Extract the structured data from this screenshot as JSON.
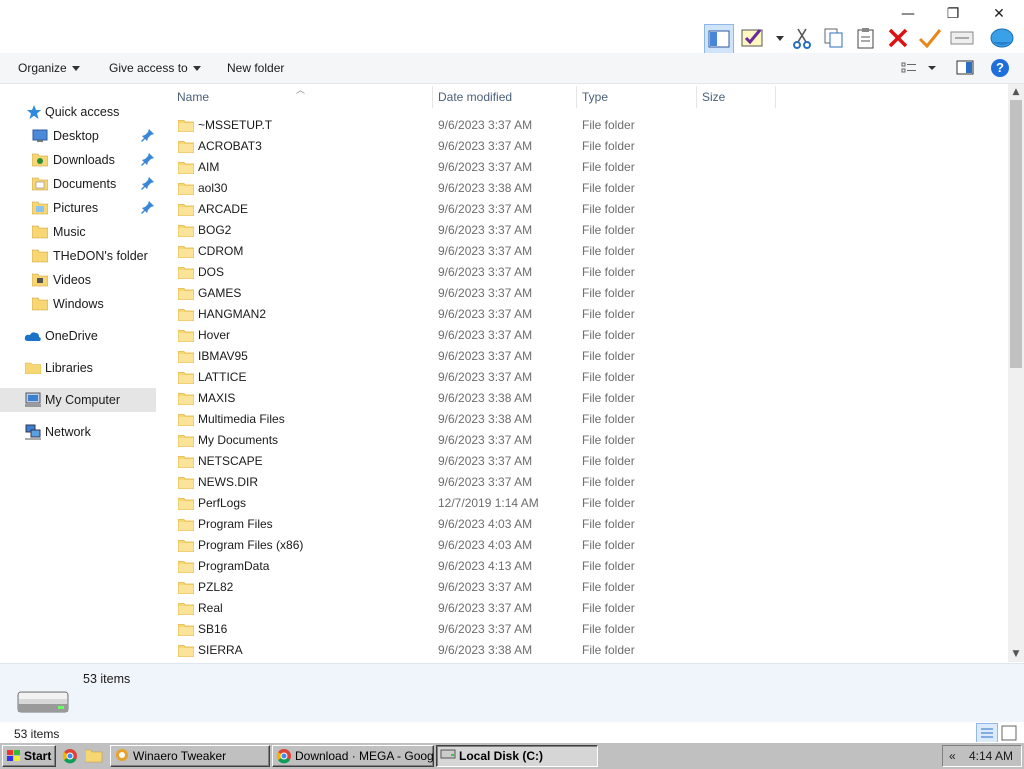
{
  "window_controls": {
    "minimize": "—",
    "maximize": "❐",
    "close": "✕"
  },
  "command_bar": {
    "organize": "Organize",
    "give_access": "Give access to",
    "new_folder": "New folder"
  },
  "nav": {
    "quick_access": "Quick access",
    "items": [
      {
        "label": "Desktop",
        "icon": "desktop-icon",
        "pinned": true
      },
      {
        "label": "Downloads",
        "icon": "downloads-icon",
        "pinned": true
      },
      {
        "label": "Documents",
        "icon": "documents-icon",
        "pinned": true
      },
      {
        "label": "Pictures",
        "icon": "pictures-icon",
        "pinned": true
      },
      {
        "label": "Music",
        "icon": "music-icon",
        "pinned": false
      },
      {
        "label": "THeDON's folder",
        "icon": "folder-icon",
        "pinned": false
      },
      {
        "label": "Videos",
        "icon": "videos-icon",
        "pinned": false
      },
      {
        "label": "Windows",
        "icon": "folder-icon",
        "pinned": false
      }
    ],
    "onedrive": "OneDrive",
    "libraries": "Libraries",
    "my_computer": "My Computer",
    "network": "Network"
  },
  "columns": {
    "name": "Name",
    "date": "Date modified",
    "type": "Type",
    "size": "Size"
  },
  "files": [
    {
      "name": "~MSSETUP.T",
      "date": "9/6/2023 3:37 AM",
      "type": "File folder"
    },
    {
      "name": "ACROBAT3",
      "date": "9/6/2023 3:37 AM",
      "type": "File folder"
    },
    {
      "name": "AIM",
      "date": "9/6/2023 3:37 AM",
      "type": "File folder"
    },
    {
      "name": "aol30",
      "date": "9/6/2023 3:38 AM",
      "type": "File folder"
    },
    {
      "name": "ARCADE",
      "date": "9/6/2023 3:37 AM",
      "type": "File folder"
    },
    {
      "name": "BOG2",
      "date": "9/6/2023 3:37 AM",
      "type": "File folder"
    },
    {
      "name": "CDROM",
      "date": "9/6/2023 3:37 AM",
      "type": "File folder"
    },
    {
      "name": "DOS",
      "date": "9/6/2023 3:37 AM",
      "type": "File folder"
    },
    {
      "name": "GAMES",
      "date": "9/6/2023 3:37 AM",
      "type": "File folder"
    },
    {
      "name": "HANGMAN2",
      "date": "9/6/2023 3:37 AM",
      "type": "File folder"
    },
    {
      "name": "Hover",
      "date": "9/6/2023 3:37 AM",
      "type": "File folder"
    },
    {
      "name": "IBMAV95",
      "date": "9/6/2023 3:37 AM",
      "type": "File folder"
    },
    {
      "name": "LATTICE",
      "date": "9/6/2023 3:37 AM",
      "type": "File folder"
    },
    {
      "name": "MAXIS",
      "date": "9/6/2023 3:38 AM",
      "type": "File folder"
    },
    {
      "name": "Multimedia Files",
      "date": "9/6/2023 3:38 AM",
      "type": "File folder"
    },
    {
      "name": "My Documents",
      "date": "9/6/2023 3:37 AM",
      "type": "File folder"
    },
    {
      "name": "NETSCAPE",
      "date": "9/6/2023 3:37 AM",
      "type": "File folder"
    },
    {
      "name": "NEWS.DIR",
      "date": "9/6/2023 3:37 AM",
      "type": "File folder"
    },
    {
      "name": "PerfLogs",
      "date": "12/7/2019 1:14 AM",
      "type": "File folder"
    },
    {
      "name": "Program Files",
      "date": "9/6/2023 4:03 AM",
      "type": "File folder"
    },
    {
      "name": "Program Files (x86)",
      "date": "9/6/2023 4:03 AM",
      "type": "File folder"
    },
    {
      "name": "ProgramData",
      "date": "9/6/2023 4:13 AM",
      "type": "File folder"
    },
    {
      "name": "PZL82",
      "date": "9/6/2023 3:37 AM",
      "type": "File folder"
    },
    {
      "name": "Real",
      "date": "9/6/2023 3:37 AM",
      "type": "File folder"
    },
    {
      "name": "SB16",
      "date": "9/6/2023 3:37 AM",
      "type": "File folder"
    },
    {
      "name": "SIERRA",
      "date": "9/6/2023 3:38 AM",
      "type": "File folder"
    }
  ],
  "details_pane": {
    "count": "53 items"
  },
  "status_bar": {
    "count": "53 items"
  },
  "taskbar": {
    "start": "Start",
    "buttons": [
      "Winaero Tweaker",
      "Download · MEGA - Googl...",
      "Local Disk (C:)"
    ],
    "clock": "4:14 AM",
    "tray_arrow": "«"
  },
  "colors": {
    "folder": "#f7d774",
    "folder_dark": "#e0b441",
    "selection": "#e5e5e5",
    "header_text": "#4c607a",
    "taskbar": "#c0c0c0"
  }
}
